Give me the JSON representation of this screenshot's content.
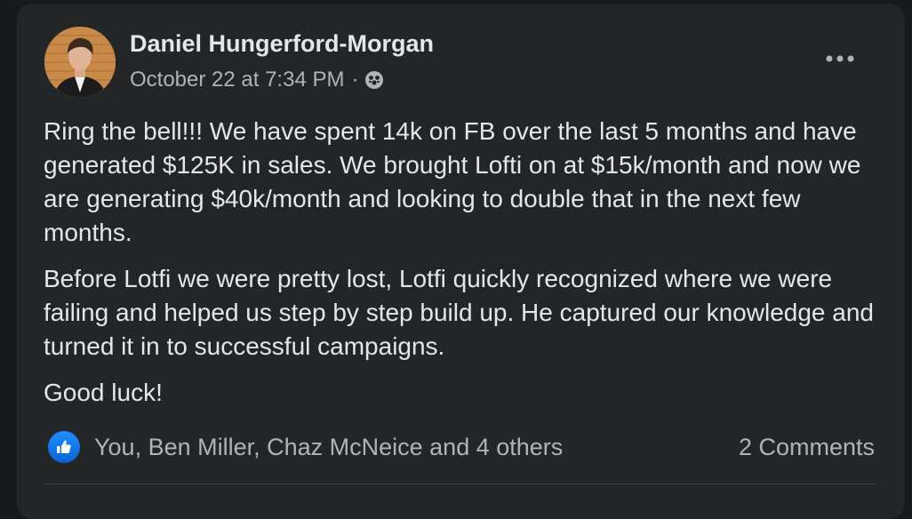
{
  "post": {
    "author": "Daniel Hungerford-Morgan",
    "timestamp": "October 22 at 7:34 PM",
    "separator": "·",
    "audience_icon": "friends-icon",
    "paragraphs": [
      "Ring the bell!!! We have spent 14k on FB over the last 5 months and have generated $125K in sales. We brought Lofti on at $15k/month and now we are generating $40k/month and looking to double that in the next few months.",
      "Before Lotfi we were pretty lost, Lotfi quickly recognized where we were failing and helped us step by step build up. He captured our knowledge and turned it in to successful campaigns.",
      "Good luck!"
    ]
  },
  "reactions": {
    "icon": "like-icon",
    "text": "You, Ben Miller, Chaz McNeice and 4 others"
  },
  "comments": {
    "label": "2 Comments"
  },
  "colors": {
    "background": "#18191a",
    "card": "#242526",
    "primary_text": "#e4e6eb",
    "secondary_text": "#b0b3b8",
    "like_blue": "#1877f2"
  }
}
